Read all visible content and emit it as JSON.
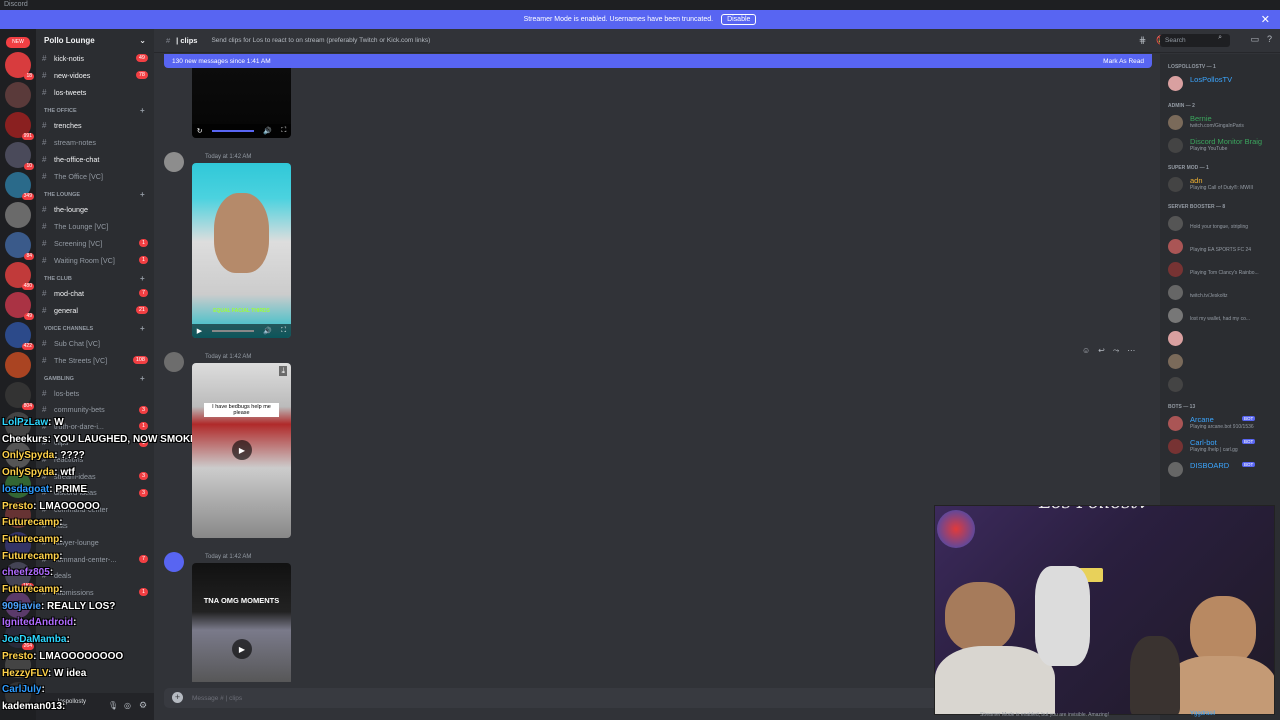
{
  "titlebar": {
    "app": "Discord"
  },
  "banner": {
    "text": "Streamer Mode is enabled. Usernames have been truncated.",
    "disable_label": "Disable",
    "color": "#5865f2"
  },
  "rail": {
    "new_label": "NEW",
    "badges": [
      "18",
      "",
      "991",
      "10",
      "349",
      "",
      "84",
      "480",
      "49",
      "422",
      "",
      "804",
      "",
      "",
      "",
      "",
      "",
      "1K+",
      "",
      "264",
      "",
      ""
    ]
  },
  "sidebar": {
    "server_name": "Pollo Lounge",
    "channels": [
      {
        "label": "kick-notis",
        "count": "49",
        "unread": true
      },
      {
        "label": "new-vidoes",
        "count": "78",
        "unread": true
      },
      {
        "label": "los-tweets",
        "count": "",
        "unread": true
      },
      {
        "cat": "THE OFFICE"
      },
      {
        "label": "trenches",
        "count": "",
        "unread": true
      },
      {
        "label": "stream-notes",
        "count": "",
        "unread": false
      },
      {
        "label": "the-office-chat",
        "count": "",
        "unread": true
      },
      {
        "label": "The Office [VC]",
        "count": "",
        "unread": false
      },
      {
        "cat": "THE LOUNGE"
      },
      {
        "label": "the-lounge",
        "count": "",
        "unread": true
      },
      {
        "label": "The Lounge [VC]",
        "count": "",
        "unread": false
      },
      {
        "label": "Screening [VC]",
        "count": "1",
        "unread": false
      },
      {
        "label": "Waiting Room [VC]",
        "count": "1",
        "unread": false
      },
      {
        "cat": "THE CLUB"
      },
      {
        "label": "mod-chat",
        "count": "7",
        "unread": true
      },
      {
        "label": "general",
        "count": "21",
        "unread": true
      },
      {
        "cat": "VOICE CHANNELS"
      },
      {
        "label": "Sub Chat [VC]",
        "count": "",
        "unread": false
      },
      {
        "label": "The Streets [VC]",
        "count": "108",
        "unread": false
      },
      {
        "cat": "GAMBLING"
      },
      {
        "label": "los-bets",
        "count": "",
        "unread": false
      },
      {
        "label": "community-bets",
        "count": "3",
        "unread": false
      },
      {
        "label": "truth-or-dare-i...",
        "count": "1",
        "unread": false
      },
      {
        "label": "clips",
        "count": "1",
        "unread": false
      },
      {
        "label": "reactions",
        "count": "",
        "unread": false
      },
      {
        "label": "stream-ideas",
        "count": "3",
        "unread": false
      },
      {
        "label": "discord-ideas",
        "count": "3",
        "unread": false
      },
      {
        "label": "command-center",
        "count": "",
        "unread": false
      },
      {
        "label": "eats",
        "count": "",
        "unread": false
      },
      {
        "label": "lawyer-lounge",
        "count": "",
        "unread": false
      },
      {
        "label": "command-center-...",
        "count": "7",
        "unread": false
      },
      {
        "label": "deals",
        "count": "",
        "unread": false
      },
      {
        "label": "submissions",
        "count": "1",
        "unread": false
      }
    ],
    "user": "lospollosty"
  },
  "overlay_chat": [
    {
      "user": "LolPzLaw",
      "msg": "W"
    },
    {
      "user": "Cheekurs",
      "msg": "YOU LAUGHED, NOW SMOKE PUSSY"
    },
    {
      "user": "OnlySpyda",
      "msg": "????"
    },
    {
      "user": "OnlySpyda",
      "msg": "wtf"
    },
    {
      "user": "losdagoat",
      "msg": "PRIME"
    },
    {
      "user": "Presto",
      "msg": "LMAOOOOO"
    },
    {
      "user": "Futurecamp",
      "msg": ""
    },
    {
      "user": "Futurecamp",
      "msg": ""
    },
    {
      "user": "Futurecamp",
      "msg": ""
    },
    {
      "user": "cheefz805",
      "msg": ""
    },
    {
      "user": "Futurecamp",
      "msg": ""
    },
    {
      "user": "909javie",
      "msg": "REALLY LOS?"
    },
    {
      "user": "IgnitedAndroid",
      "msg": ""
    },
    {
      "user": "JoeDaMamba",
      "msg": ""
    },
    {
      "user": "Presto",
      "msg": "LMAOOOOOOOO"
    },
    {
      "user": "HezzyFLV",
      "msg": "W idea"
    },
    {
      "user": "CarlJuly",
      "msg": ""
    },
    {
      "user": "kademan013",
      "msg": ""
    }
  ],
  "topbar": {
    "channel": "| clips",
    "topic": "Send clips for Los to react to on stream (preferably Twitch or Kick.com links)",
    "search_placeholder": "Search"
  },
  "newbar": {
    "text": "130 new messages since 1:41 AM",
    "action": "Mark As Read"
  },
  "messages": [
    {
      "time": "Today at 1:42 AM"
    },
    {
      "time": "Today at 1:42 AM",
      "caption": "EQUAL FACIAL THIRDS"
    },
    {
      "time": "Today at 1:42 AM",
      "caption": "I have bedbugs help me please"
    },
    {
      "time": "Today at 1:42 AM",
      "caption": "TNA OMG MOMENTS"
    }
  ],
  "composer": {
    "placeholder": "Message #   | clips"
  },
  "members": {
    "groups": [
      {
        "title": "LOSPOLLOSTV — 1",
        "members": [
          {
            "name": "LosPollosTV",
            "sub": "",
            "color": "#3ba6ff"
          }
        ]
      },
      {
        "title": "ADMIN — 2",
        "members": [
          {
            "name": "Bernie",
            "sub": "twitch.com/GingaInParis",
            "color": "#3ba55d"
          },
          {
            "name": "Discord Monitor Braig",
            "sub": "Playing YouTube",
            "color": "#3ba55d"
          }
        ]
      },
      {
        "title": "SUPER MOD — 1",
        "members": [
          {
            "name": "adn",
            "sub": "Playing Call of Duty®: MWIII",
            "color": "#f0b232"
          }
        ]
      },
      {
        "title": "SERVER BOOSTER — 8",
        "members": [
          {
            "name": "",
            "sub": "Hold your tongue, stripling",
            "color": "#f47fff"
          },
          {
            "name": "",
            "sub": "Playing EA SPORTS FC 24",
            "color": "#f47fff"
          },
          {
            "name": "",
            "sub": "Playing Tom Clancy's Rainbo...",
            "color": "#f47fff"
          },
          {
            "name": "",
            "sub": "twitch.tv/Jeskoltz",
            "color": "#f47fff"
          },
          {
            "name": "",
            "sub": "lost my wallet, had my co...",
            "color": "#f47fff"
          },
          {
            "name": "",
            "sub": "",
            "color": "#f47fff"
          },
          {
            "name": "",
            "sub": "",
            "color": "#f47fff"
          },
          {
            "name": "",
            "sub": "",
            "color": "#f47fff"
          }
        ]
      },
      {
        "title": "BOTS — 13",
        "members": [
          {
            "name": "Arcane",
            "sub": "Playing arcane.bot 910/1536",
            "color": "#3ba6ff",
            "bot": "BOT"
          },
          {
            "name": "Carl-bot",
            "sub": "Playing /help | carl.gg",
            "color": "#3ba6ff",
            "bot": "BOT"
          },
          {
            "name": "DISBOARD",
            "sub": "",
            "color": "#3ba6ff",
            "bot": "BOT"
          }
        ]
      }
    ]
  },
  "webcam": {
    "logo_text": "Los Pollostv",
    "sign_text": ""
  },
  "footer": {
    "text": "Streamer Mode is enabled, but you are invisible. Amazing!",
    "bot": "Yggdrasil"
  }
}
